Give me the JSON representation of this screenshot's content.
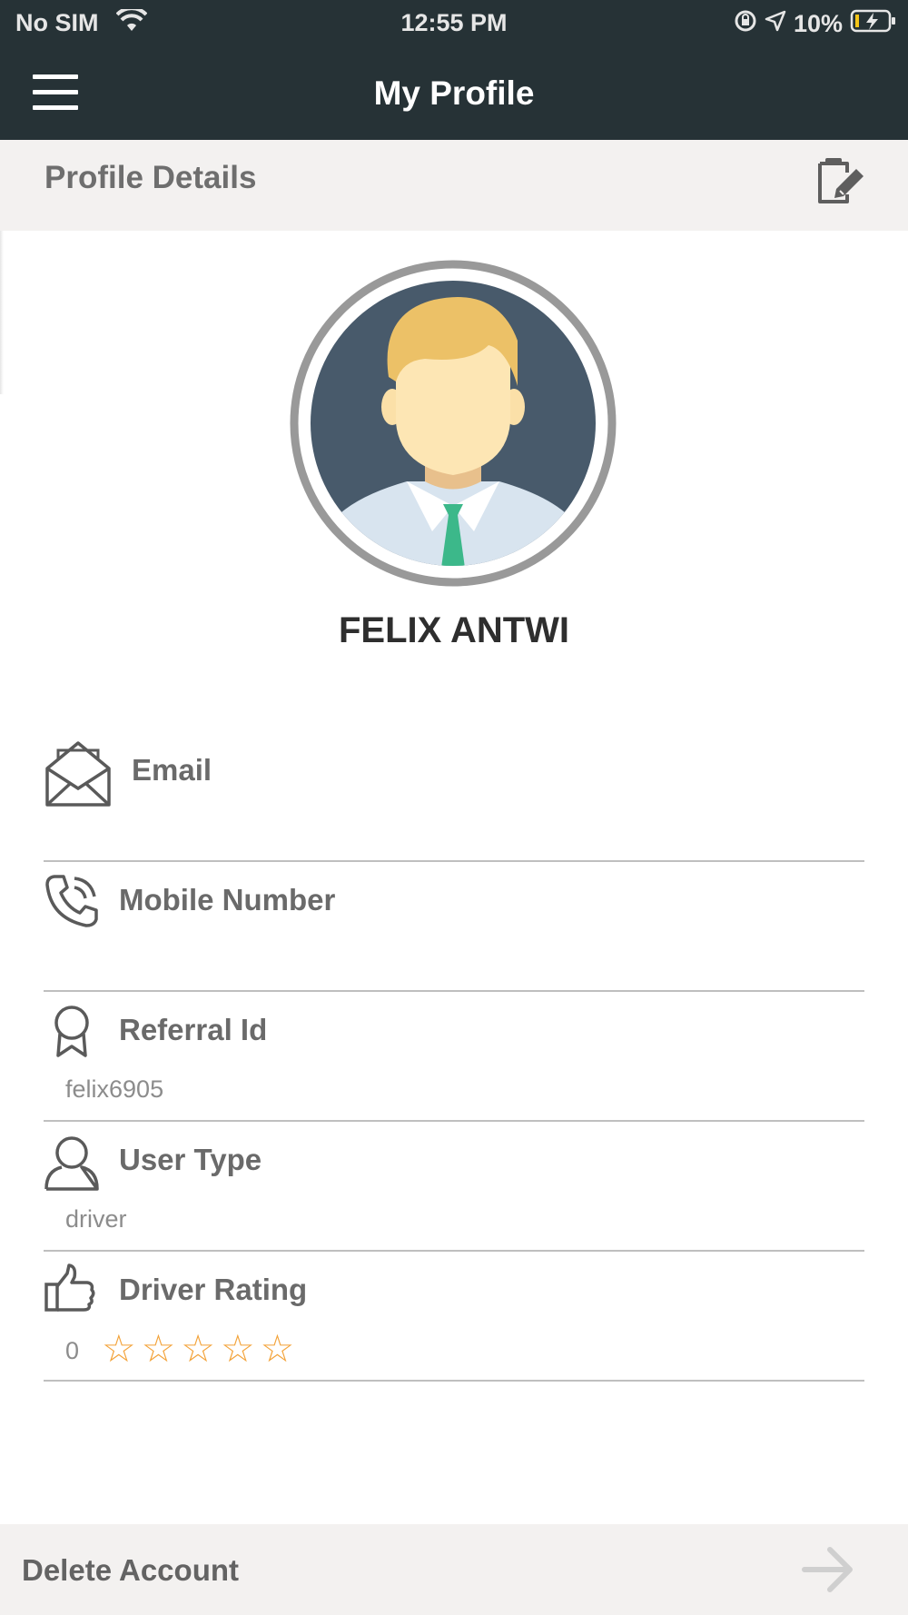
{
  "status_bar": {
    "carrier": "No SIM",
    "time": "12:55 PM",
    "battery": "10%"
  },
  "nav": {
    "title": "My Profile",
    "menu_icon": "hamburger-menu-icon"
  },
  "section": {
    "title": "Profile Details",
    "edit_icon": "edit-note-icon"
  },
  "profile": {
    "name": "FELIX ANTWI",
    "avatar_icon": "male-avatar-icon"
  },
  "fields": {
    "email": {
      "label": "Email",
      "value": "",
      "icon": "open-envelope-icon"
    },
    "mobile": {
      "label": "Mobile Number",
      "value": "",
      "icon": "phone-ringing-icon"
    },
    "referral": {
      "label": "Referral Id",
      "value": "felix6905",
      "icon": "award-ribbon-icon"
    },
    "user_type": {
      "label": "User Type",
      "value": "driver",
      "icon": "user-icon"
    },
    "driver_rating": {
      "label": "Driver Rating",
      "value": "0",
      "stars_filled": 0,
      "stars_total": 5,
      "star_glyphs": "☆☆☆☆☆",
      "icon": "thumbs-up-icon"
    }
  },
  "footer": {
    "delete_label": "Delete Account",
    "arrow_icon": "arrow-right-icon"
  },
  "colors": {
    "header_bg": "#263236",
    "section_bg": "#f3f1f0",
    "star": "#f3a33a"
  }
}
